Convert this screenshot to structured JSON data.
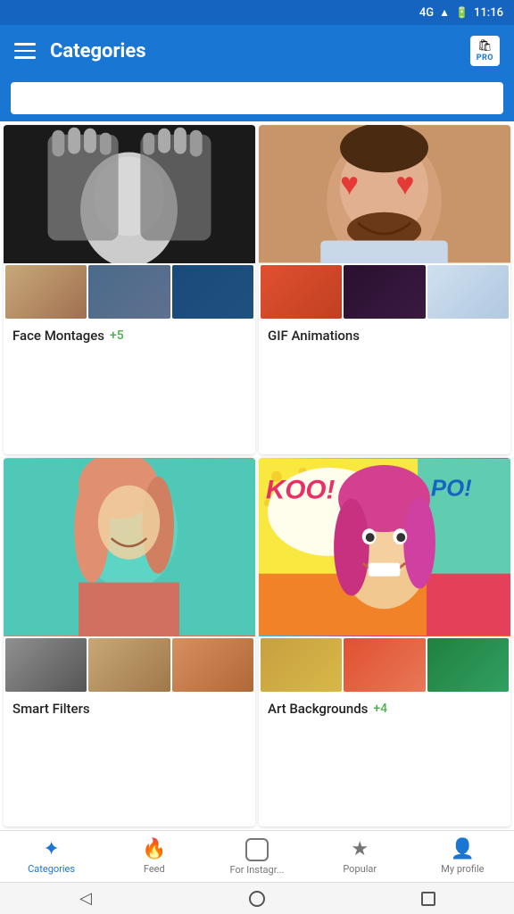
{
  "statusBar": {
    "network": "4G",
    "time": "11:16",
    "batteryIcon": "🔋"
  },
  "appBar": {
    "title": "Categories",
    "proBadge": "PRO"
  },
  "search": {
    "placeholder": ""
  },
  "categories": [
    {
      "id": "face-montages",
      "label": "Face Montages",
      "count": "+5",
      "thumbnails": [
        "person with hands",
        "robot face",
        "girl in blue"
      ]
    },
    {
      "id": "gif-animations",
      "label": "GIF Animations",
      "count": "",
      "thumbnails": [
        "colorful face",
        "dark portrait",
        "winter girl"
      ]
    },
    {
      "id": "smart-filters",
      "label": "Smart Filters",
      "count": "",
      "thumbnails": [
        "bw portrait",
        "warm tones",
        "orange tones"
      ]
    },
    {
      "id": "art-backgrounds",
      "label": "Art Backgrounds",
      "count": "+4",
      "thumbnails": [
        "golden portrait",
        "colorful art",
        "green tones"
      ]
    }
  ],
  "bottomNav": {
    "items": [
      {
        "id": "categories",
        "label": "Categories",
        "icon": "✦",
        "active": true
      },
      {
        "id": "feed",
        "label": "Feed",
        "icon": "🔥",
        "active": false
      },
      {
        "id": "instagram",
        "label": "For Instagr...",
        "icon": "⊙",
        "active": false
      },
      {
        "id": "popular",
        "label": "Popular",
        "icon": "★",
        "active": false
      },
      {
        "id": "profile",
        "label": "My profile",
        "icon": "👤",
        "active": false
      }
    ]
  }
}
